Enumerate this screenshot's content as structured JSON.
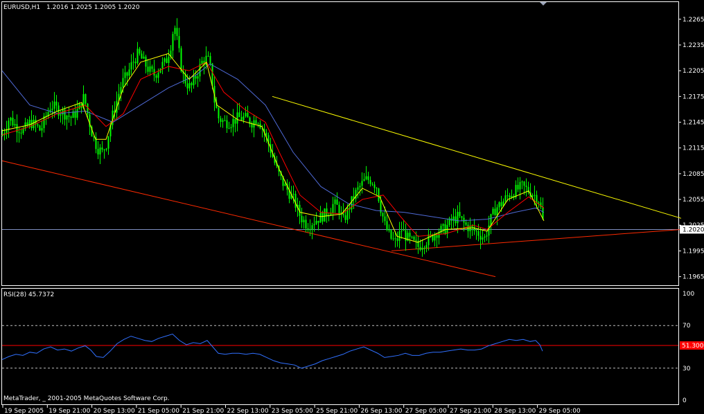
{
  "header": {
    "symbol_label": "EURUSD,H1",
    "ohlc": "1.2016 1.2025 1.2005 1.2020"
  },
  "footer": {
    "copyright": "MetaTrader, _ 2001-2005 MetaQuotes Software Corp."
  },
  "colors": {
    "background": "#000000",
    "frame": "#ffffff",
    "candles": "#00ff00",
    "ma_fast": "#ffff00",
    "ma_mid": "#ff0000",
    "ma_slow": "#4f6ad6",
    "trend_upper": "#ffff00",
    "trend_lower": "#ff2a00",
    "trend_support": "#ff2a00",
    "bid_line": "#7f8fc0",
    "rsi_line": "#3070ff",
    "rsi_level": "#ff0000",
    "rsi_guides": "#c0c0c0"
  },
  "chart_data": [
    {
      "type": "candlestick",
      "title": "EURUSD,H1",
      "ylim": [
        1.1955,
        1.2285
      ],
      "yticks": [
        "1.2265",
        "1.2235",
        "1.2205",
        "1.2175",
        "1.2145",
        "1.2115",
        "1.2085",
        "1.2055",
        "1.2025",
        "1.1995",
        "1.1965"
      ],
      "current_price": "1.2020",
      "xticks": [
        "19 Sep 2005",
        "19 Sep 21:00",
        "20 Sep 13:00",
        "21 Sep 05:00",
        "21 Sep 21:00",
        "22 Sep 13:00",
        "23 Sep 05:00",
        "25 Sep 21:00",
        "26 Sep 13:00",
        "27 Sep 05:00",
        "27 Sep 21:00",
        "28 Sep 13:00",
        "29 Sep 05:00"
      ],
      "close_path": [
        [
          0,
          1.213
        ],
        [
          10,
          1.215
        ],
        [
          20,
          1.214
        ],
        [
          30,
          1.2135
        ],
        [
          40,
          1.2145
        ],
        [
          50,
          1.214
        ],
        [
          55,
          1.2135
        ],
        [
          62,
          1.215
        ],
        [
          70,
          1.2165
        ],
        [
          80,
          1.216
        ],
        [
          90,
          1.2155
        ],
        [
          100,
          1.215
        ],
        [
          110,
          1.216
        ],
        [
          118,
          1.2175
        ],
        [
          124,
          1.215
        ],
        [
          130,
          1.213
        ],
        [
          137,
          1.2115
        ],
        [
          144,
          1.211
        ],
        [
          150,
          1.212
        ],
        [
          158,
          1.215
        ],
        [
          165,
          1.217
        ],
        [
          172,
          1.219
        ],
        [
          180,
          1.22
        ],
        [
          188,
          1.2215
        ],
        [
          196,
          1.2225
        ],
        [
          204,
          1.2215
        ],
        [
          212,
          1.2205
        ],
        [
          220,
          1.22
        ],
        [
          228,
          1.221
        ],
        [
          236,
          1.2215
        ],
        [
          243,
          1.2235
        ],
        [
          248,
          1.226
        ],
        [
          254,
          1.223
        ],
        [
          260,
          1.22
        ],
        [
          266,
          1.219
        ],
        [
          272,
          1.2185
        ],
        [
          280,
          1.22
        ],
        [
          288,
          1.2215
        ],
        [
          296,
          1.222
        ],
        [
          301,
          1.2205
        ],
        [
          306,
          1.217
        ],
        [
          312,
          1.215
        ],
        [
          320,
          1.2145
        ],
        [
          330,
          1.2145
        ],
        [
          340,
          1.215
        ],
        [
          350,
          1.215
        ],
        [
          360,
          1.2145
        ],
        [
          368,
          1.215
        ],
        [
          374,
          1.214
        ],
        [
          380,
          1.213
        ],
        [
          388,
          1.211
        ],
        [
          396,
          1.209
        ],
        [
          404,
          1.2075
        ],
        [
          412,
          1.2065
        ],
        [
          420,
          1.2055
        ],
        [
          430,
          1.2035
        ],
        [
          440,
          1.2025
        ],
        [
          450,
          1.203
        ],
        [
          460,
          1.2035
        ],
        [
          470,
          1.204
        ],
        [
          478,
          1.205
        ],
        [
          485,
          1.2045
        ],
        [
          492,
          1.203
        ],
        [
          500,
          1.2045
        ],
        [
          508,
          1.206
        ],
        [
          516,
          1.207
        ],
        [
          524,
          1.2078
        ],
        [
          532,
          1.2078
        ],
        [
          540,
          1.207
        ],
        [
          546,
          1.2045
        ],
        [
          552,
          1.2025
        ],
        [
          560,
          1.201
        ],
        [
          568,
          1.2005
        ],
        [
          576,
          1.202
        ],
        [
          584,
          1.201
        ],
        [
          592,
          1.2005
        ],
        [
          600,
          1.2
        ],
        [
          608,
          1.2005
        ],
        [
          618,
          1.201
        ],
        [
          628,
          1.2018
        ],
        [
          638,
          1.202
        ],
        [
          648,
          1.203
        ],
        [
          658,
          1.2035
        ],
        [
          668,
          1.2025
        ],
        [
          678,
          1.202
        ],
        [
          688,
          1.2015
        ],
        [
          696,
          1.201
        ],
        [
          704,
          1.203
        ],
        [
          712,
          1.2045
        ],
        [
          720,
          1.205
        ],
        [
          730,
          1.206
        ],
        [
          740,
          1.2065
        ],
        [
          750,
          1.207
        ],
        [
          760,
          1.2065
        ],
        [
          768,
          1.206
        ],
        [
          774,
          1.2055
        ],
        [
          778,
          1.204
        ],
        [
          782,
          1.202
        ]
      ],
      "ma_fast_path": [
        [
          0,
          1.2135
        ],
        [
          40,
          1.2142
        ],
        [
          80,
          1.2158
        ],
        [
          115,
          1.2168
        ],
        [
          135,
          1.2125
        ],
        [
          150,
          1.2125
        ],
        [
          175,
          1.2185
        ],
        [
          200,
          1.2215
        ],
        [
          240,
          1.2225
        ],
        [
          270,
          1.2195
        ],
        [
          295,
          1.2215
        ],
        [
          310,
          1.2165
        ],
        [
          340,
          1.2148
        ],
        [
          375,
          1.214
        ],
        [
          400,
          1.209
        ],
        [
          430,
          1.204
        ],
        [
          460,
          1.2035
        ],
        [
          490,
          1.2038
        ],
        [
          520,
          1.2068
        ],
        [
          545,
          1.2058
        ],
        [
          570,
          1.2012
        ],
        [
          600,
          1.2005
        ],
        [
          640,
          1.202
        ],
        [
          680,
          1.2022
        ],
        [
          700,
          1.2018
        ],
        [
          730,
          1.2055
        ],
        [
          760,
          1.2065
        ],
        [
          782,
          1.203
        ]
      ],
      "ma_mid_path": [
        [
          0,
          1.213
        ],
        [
          40,
          1.214
        ],
        [
          80,
          1.2155
        ],
        [
          120,
          1.2165
        ],
        [
          150,
          1.214
        ],
        [
          175,
          1.2155
        ],
        [
          200,
          1.2195
        ],
        [
          240,
          1.221
        ],
        [
          270,
          1.2205
        ],
        [
          295,
          1.2215
        ],
        [
          320,
          1.218
        ],
        [
          350,
          1.216
        ],
        [
          380,
          1.2145
        ],
        [
          400,
          1.211
        ],
        [
          430,
          1.206
        ],
        [
          460,
          1.204
        ],
        [
          490,
          1.2038
        ],
        [
          520,
          1.2055
        ],
        [
          550,
          1.206
        ],
        [
          575,
          1.2035
        ],
        [
          600,
          1.2012
        ],
        [
          640,
          1.2015
        ],
        [
          680,
          1.2025
        ],
        [
          700,
          1.202
        ],
        [
          730,
          1.204
        ],
        [
          760,
          1.2058
        ],
        [
          782,
          1.2045
        ]
      ],
      "ma_slow_path": [
        [
          0,
          1.2205
        ],
        [
          40,
          1.2165
        ],
        [
          80,
          1.2155
        ],
        [
          120,
          1.2158
        ],
        [
          160,
          1.2145
        ],
        [
          200,
          1.2165
        ],
        [
          240,
          1.2185
        ],
        [
          280,
          1.22
        ],
        [
          300,
          1.2213
        ],
        [
          340,
          1.2195
        ],
        [
          380,
          1.2165
        ],
        [
          420,
          1.211
        ],
        [
          460,
          1.207
        ],
        [
          500,
          1.205
        ],
        [
          540,
          1.2042
        ],
        [
          580,
          1.204
        ],
        [
          620,
          1.2035
        ],
        [
          660,
          1.203
        ],
        [
          700,
          1.2032
        ],
        [
          740,
          1.204
        ],
        [
          770,
          1.2045
        ],
        [
          782,
          1.204
        ]
      ],
      "trend_lines": [
        {
          "name": "upper",
          "from": [
            390,
            1.2175
          ],
          "to": [
            980,
            1.2033
          ]
        },
        {
          "name": "lower",
          "from": [
            0,
            1.21
          ],
          "to": [
            712,
            1.1965
          ]
        },
        {
          "name": "support",
          "from": [
            562,
            1.1995
          ],
          "to": [
            980,
            1.202
          ]
        }
      ]
    },
    {
      "type": "line",
      "title": "RSI(28) 45.7372",
      "ylim": [
        0,
        100
      ],
      "yticks": [
        "100",
        "70",
        "30",
        "0"
      ],
      "levels": [
        70,
        50,
        30
      ],
      "level_label": "51.3000",
      "level_value": 51.3,
      "values_path": [
        [
          0,
          38
        ],
        [
          10,
          41
        ],
        [
          20,
          43
        ],
        [
          30,
          42
        ],
        [
          40,
          45
        ],
        [
          50,
          44
        ],
        [
          60,
          48
        ],
        [
          70,
          50
        ],
        [
          80,
          47
        ],
        [
          90,
          48
        ],
        [
          100,
          46
        ],
        [
          110,
          49
        ],
        [
          120,
          51
        ],
        [
          128,
          47
        ],
        [
          136,
          41
        ],
        [
          146,
          40
        ],
        [
          156,
          46
        ],
        [
          166,
          53
        ],
        [
          176,
          57
        ],
        [
          186,
          60
        ],
        [
          196,
          58
        ],
        [
          206,
          56
        ],
        [
          216,
          55
        ],
        [
          226,
          58
        ],
        [
          236,
          60
        ],
        [
          246,
          62
        ],
        [
          256,
          56
        ],
        [
          266,
          52
        ],
        [
          276,
          54
        ],
        [
          286,
          53
        ],
        [
          296,
          56
        ],
        [
          304,
          50
        ],
        [
          312,
          44
        ],
        [
          322,
          43
        ],
        [
          332,
          44
        ],
        [
          342,
          44
        ],
        [
          352,
          43
        ],
        [
          362,
          44
        ],
        [
          372,
          43
        ],
        [
          382,
          40
        ],
        [
          392,
          37
        ],
        [
          402,
          35
        ],
        [
          412,
          34
        ],
        [
          422,
          33
        ],
        [
          432,
          30
        ],
        [
          442,
          32
        ],
        [
          452,
          34
        ],
        [
          462,
          37
        ],
        [
          472,
          39
        ],
        [
          482,
          41
        ],
        [
          492,
          43
        ],
        [
          502,
          46
        ],
        [
          512,
          48
        ],
        [
          522,
          50
        ],
        [
          532,
          47
        ],
        [
          542,
          44
        ],
        [
          552,
          40
        ],
        [
          562,
          41
        ],
        [
          572,
          42
        ],
        [
          582,
          44
        ],
        [
          592,
          42
        ],
        [
          602,
          42
        ],
        [
          612,
          44
        ],
        [
          622,
          45
        ],
        [
          632,
          45
        ],
        [
          642,
          46
        ],
        [
          652,
          47
        ],
        [
          662,
          48
        ],
        [
          672,
          47
        ],
        [
          682,
          47
        ],
        [
          692,
          48
        ],
        [
          702,
          51
        ],
        [
          712,
          53
        ],
        [
          722,
          55
        ],
        [
          732,
          57
        ],
        [
          742,
          56
        ],
        [
          752,
          57
        ],
        [
          762,
          55
        ],
        [
          770,
          56
        ],
        [
          776,
          52
        ],
        [
          780,
          46
        ]
      ]
    }
  ]
}
